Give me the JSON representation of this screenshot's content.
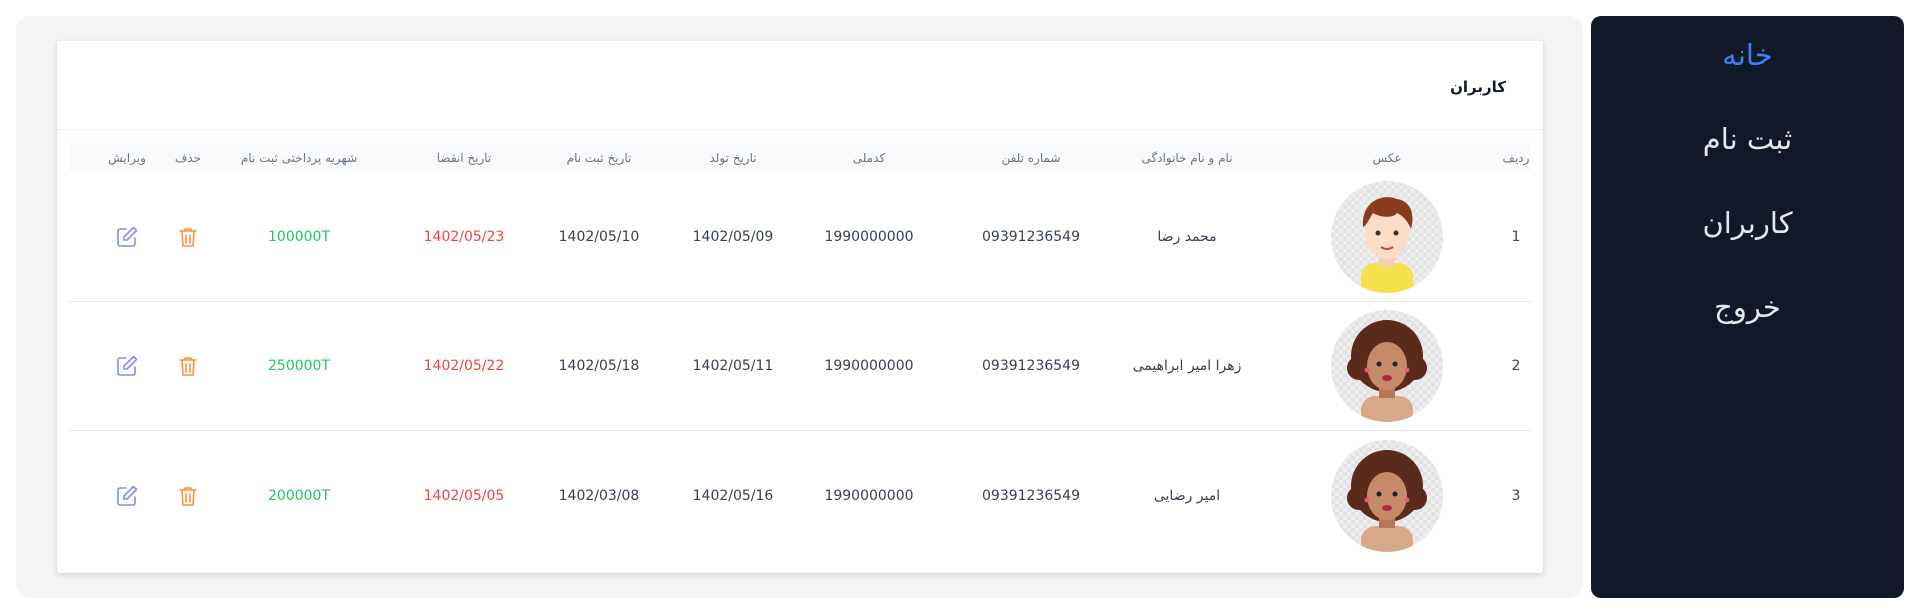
{
  "sidebar": {
    "items": [
      {
        "label": "خانه",
        "active": true
      },
      {
        "label": "ثبت نام",
        "active": false
      },
      {
        "label": "کاربران",
        "active": false
      },
      {
        "label": "خروج",
        "active": false
      }
    ]
  },
  "card": {
    "title": "کاربران"
  },
  "table": {
    "headers": {
      "index": "ردیف",
      "photo": "عکس",
      "name": "نام و نام خانوادگی",
      "phone": "شماره تلفن",
      "national_id": "کدملی",
      "birth_date": "تاریخ تولد",
      "register_date": "تاریخ ثبت نام",
      "expire_date": "تاریخ انقضا",
      "fee": "شهریه پرداختی ثبت نام",
      "delete": "حذف",
      "edit": "ویرایش"
    },
    "rows": [
      {
        "index": "1",
        "avatar": "boy-avatar",
        "name": "محمد رضا",
        "phone": "09391236549",
        "national_id": "1990000000",
        "birth_date": "1402/05/09",
        "register_date": "1402/05/10",
        "expire_date": "1402/05/23",
        "fee": "100000T"
      },
      {
        "index": "2",
        "avatar": "girl-avatar",
        "name": "زهرا امیر ابراهیمی",
        "phone": "09391236549",
        "national_id": "1990000000",
        "birth_date": "1402/05/11",
        "register_date": "1402/05/18",
        "expire_date": "1402/05/22",
        "fee": "250000T"
      },
      {
        "index": "3",
        "avatar": "girl-avatar",
        "name": "امیر رضایی",
        "phone": "09391236549",
        "national_id": "1990000000",
        "birth_date": "1402/05/16",
        "register_date": "1402/03/08",
        "expire_date": "1402/05/05",
        "fee": "200000T"
      }
    ]
  },
  "colors": {
    "sidebar_bg": "#111827",
    "active_link": "#3b82f6",
    "expire_red": "#ef4444",
    "fee_green": "#22c55e",
    "delete_orange": "#fb923c",
    "edit_purple": "#818cf8"
  },
  "icons": {
    "delete": "trash-icon",
    "edit": "pencil-square-icon"
  }
}
